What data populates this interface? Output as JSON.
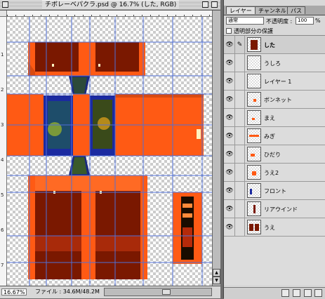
{
  "window": {
    "title": "チボレーベパクラ.psd @ 16.7% (した, RGB)",
    "zoom": "16.67%",
    "file_info": "ファイル : 34.6M/48.2M"
  },
  "rulers": {
    "left_labels": [
      "1",
      "2",
      "3",
      "4",
      "5",
      "6",
      "7"
    ]
  },
  "palette": {
    "tabs": [
      "レイヤー",
      "チャンネル",
      "パス"
    ],
    "blend_mode": "通常",
    "opacity_label": "不透明度 :",
    "opacity_value": "100",
    "opacity_unit": "%",
    "preserve_transparency": "透明部分の保護",
    "layers": [
      {
        "name": "した",
        "visible": true,
        "selected": true
      },
      {
        "name": "うしろ",
        "visible": true,
        "selected": false
      },
      {
        "name": "レイヤー 1",
        "visible": true,
        "selected": false
      },
      {
        "name": "ボンネット",
        "visible": true,
        "selected": false
      },
      {
        "name": "まえ",
        "visible": true,
        "selected": false
      },
      {
        "name": "みぎ",
        "visible": true,
        "selected": false
      },
      {
        "name": "ひだり",
        "visible": true,
        "selected": false
      },
      {
        "name": "うえ2",
        "visible": true,
        "selected": false
      },
      {
        "name": "フロント",
        "visible": true,
        "selected": false
      },
      {
        "name": "リアウインド",
        "visible": true,
        "selected": false
      },
      {
        "name": "うえ",
        "visible": true,
        "selected": false
      }
    ]
  },
  "colors": {
    "orange": "#ff5a14",
    "dark_red": "#7a1800",
    "guide": "#4f6fd8"
  },
  "icons": [
    "eye-icon",
    "brush-icon",
    "new-layer-icon",
    "trash-icon"
  ]
}
